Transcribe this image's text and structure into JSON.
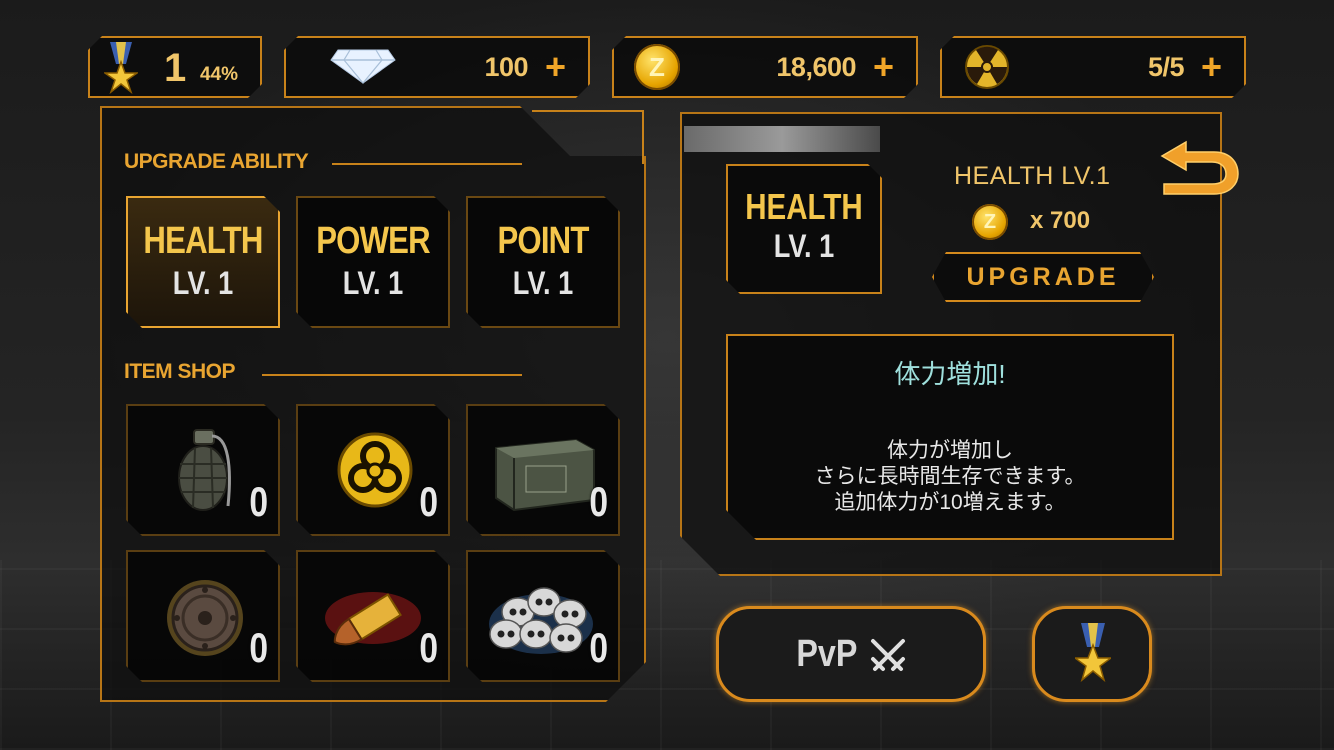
{
  "topbar": {
    "rank": {
      "level": "1",
      "percent": "44%"
    },
    "gems": {
      "value": "100",
      "plus": "+"
    },
    "coins": {
      "value": "18,600",
      "plus": "+",
      "coin_letter": "Z"
    },
    "energy": {
      "value": "5/5",
      "plus": "+"
    }
  },
  "left_panel": {
    "upgrade_title": "UPGRADE ABILITY",
    "abilities": [
      {
        "name": "HEALTH",
        "level": "LV. 1",
        "selected": true
      },
      {
        "name": "POWER",
        "level": "LV. 1",
        "selected": false
      },
      {
        "name": "POINT",
        "level": "LV. 1",
        "selected": false
      }
    ],
    "shop_title": "ITEM SHOP",
    "items": [
      {
        "icon": "grenade-icon",
        "count": "0"
      },
      {
        "icon": "biohazard-icon",
        "count": "0"
      },
      {
        "icon": "ammo-box-icon",
        "count": "0"
      },
      {
        "icon": "shield-icon",
        "count": "0"
      },
      {
        "icon": "bullet-icon",
        "count": "0"
      },
      {
        "icon": "skulls-icon",
        "count": "0"
      }
    ]
  },
  "detail": {
    "card_name": "HEALTH",
    "card_level": "LV. 1",
    "title": "HEALTH LV.1",
    "cost": "x 700",
    "coin_letter": "Z",
    "upgrade_label": "UPGRADE",
    "desc_title": "体力増加!",
    "desc_lines": [
      "体力が増加し",
      "さらに長時間生存できます。",
      "追加体力が10増えます。"
    ]
  },
  "bottom": {
    "pvp_label": "PvP"
  },
  "colors": {
    "accent": "#e9a531",
    "border": "#c8821a",
    "desc_title": "#9fe0dd"
  }
}
